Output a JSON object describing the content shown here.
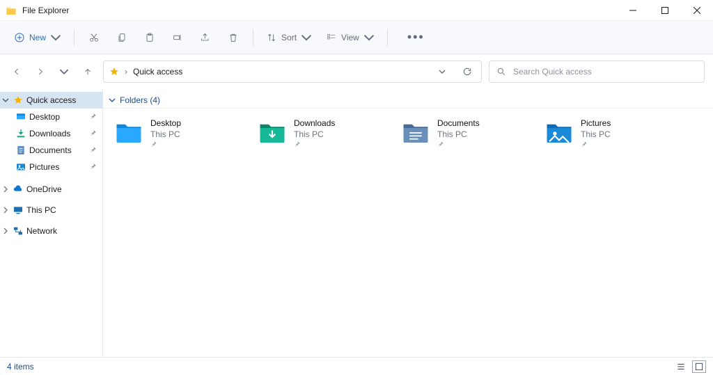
{
  "window": {
    "title": "File Explorer"
  },
  "toolbar": {
    "new_label": "New",
    "sort_label": "Sort",
    "view_label": "View"
  },
  "address": {
    "location": "Quick access"
  },
  "search": {
    "placeholder": "Search Quick access"
  },
  "sidebar": {
    "quick_access": "Quick access",
    "items": [
      {
        "label": "Desktop"
      },
      {
        "label": "Downloads"
      },
      {
        "label": "Documents"
      },
      {
        "label": "Pictures"
      }
    ],
    "onedrive": "OneDrive",
    "this_pc": "This PC",
    "network": "Network"
  },
  "content": {
    "group_label": "Folders (4)",
    "location_label": "This PC",
    "folders": [
      {
        "name": "Desktop"
      },
      {
        "name": "Downloads"
      },
      {
        "name": "Documents"
      },
      {
        "name": "Pictures"
      }
    ]
  },
  "status": {
    "items": "4 items"
  }
}
